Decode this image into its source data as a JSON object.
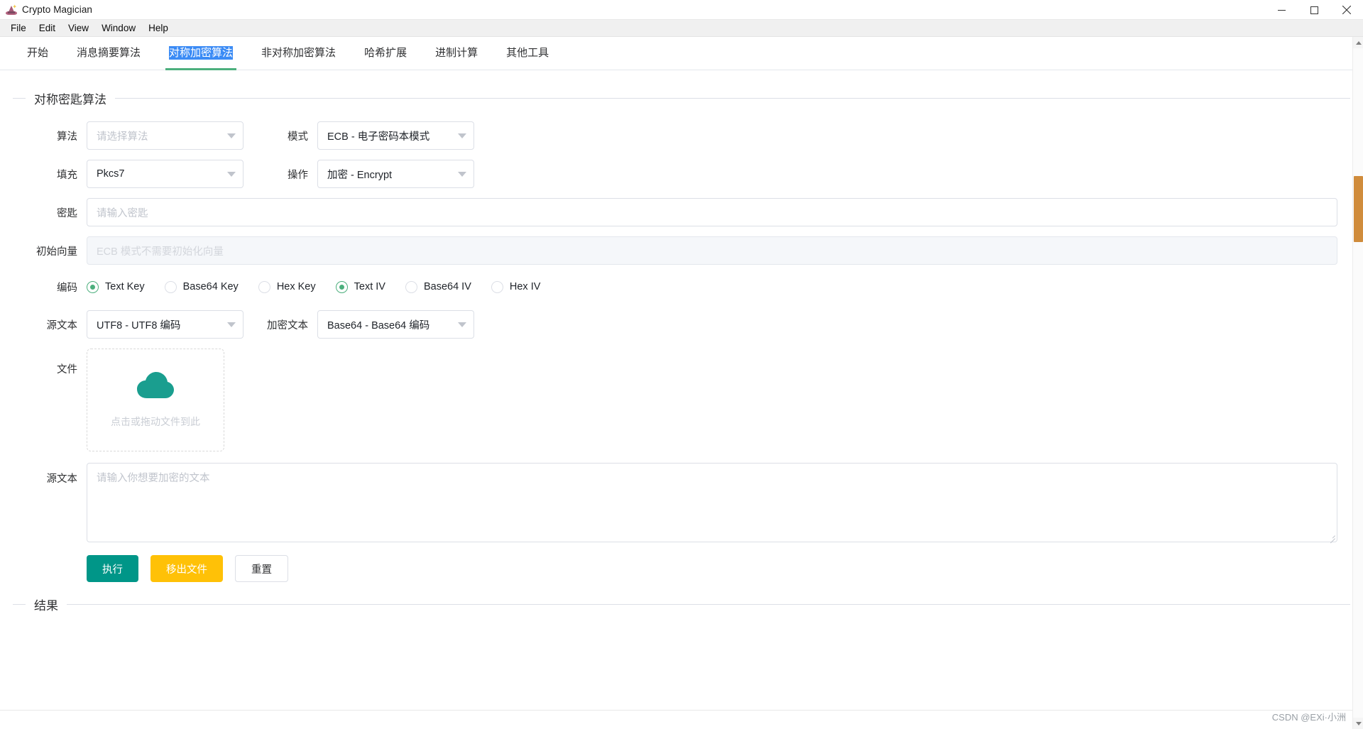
{
  "window": {
    "title": "Crypto Magician",
    "icon": "wizard-hat-icon",
    "minimize": "minimize",
    "maximize": "maximize",
    "close": "close"
  },
  "menu": {
    "items": [
      "File",
      "Edit",
      "View",
      "Window",
      "Help"
    ]
  },
  "tabs": [
    {
      "label": "开始",
      "active": false
    },
    {
      "label": "消息摘要算法",
      "active": false
    },
    {
      "label": "对称加密算法",
      "active": true
    },
    {
      "label": "非对称加密算法",
      "active": false
    },
    {
      "label": "哈希扩展",
      "active": false
    },
    {
      "label": "进制计算",
      "active": false
    },
    {
      "label": "其他工具",
      "active": false
    }
  ],
  "group": {
    "legend": "对称密匙算法",
    "result_legend": "结果"
  },
  "form": {
    "algorithm": {
      "label": "算法",
      "value": "请选择算法",
      "is_placeholder": true
    },
    "mode": {
      "label": "模式",
      "value": "ECB - 电子密码本模式"
    },
    "padding": {
      "label": "填充",
      "value": "Pkcs7"
    },
    "operation": {
      "label": "操作",
      "value": "加密 - Encrypt"
    },
    "key": {
      "label": "密匙",
      "placeholder": "请输入密匙",
      "value": ""
    },
    "iv": {
      "label": "初始向量",
      "placeholder": "ECB 模式不需要初始化向量",
      "value": "",
      "disabled": true
    },
    "encoding": {
      "label": "编码",
      "options": [
        {
          "label": "Text Key",
          "checked": true
        },
        {
          "label": "Base64 Key",
          "checked": false
        },
        {
          "label": "Hex Key",
          "checked": false
        },
        {
          "label": "Text IV",
          "checked": true
        },
        {
          "label": "Base64 IV",
          "checked": false
        },
        {
          "label": "Hex IV",
          "checked": false
        }
      ]
    },
    "source_encoding": {
      "label": "源文本",
      "value": "UTF8 - UTF8 编码"
    },
    "cipher_encoding": {
      "label": "加密文本",
      "value": "Base64 - Base64 编码"
    },
    "file": {
      "label": "文件",
      "hint": "点击或拖动文件到此",
      "icon": "cloud-upload-icon"
    },
    "source_text": {
      "label": "源文本",
      "placeholder": "请输入你想要加密的文本",
      "value": ""
    }
  },
  "buttons": {
    "execute": "执行",
    "remove_file": "移出文件",
    "reset": "重置"
  },
  "watermark": "CSDN @EXi·小洲",
  "colors": {
    "primary": "#009688",
    "warn": "#ffc107",
    "tab_underline": "#4caf7d",
    "selection": "#3b8bf5",
    "radio_checked": "#4caf7d"
  }
}
